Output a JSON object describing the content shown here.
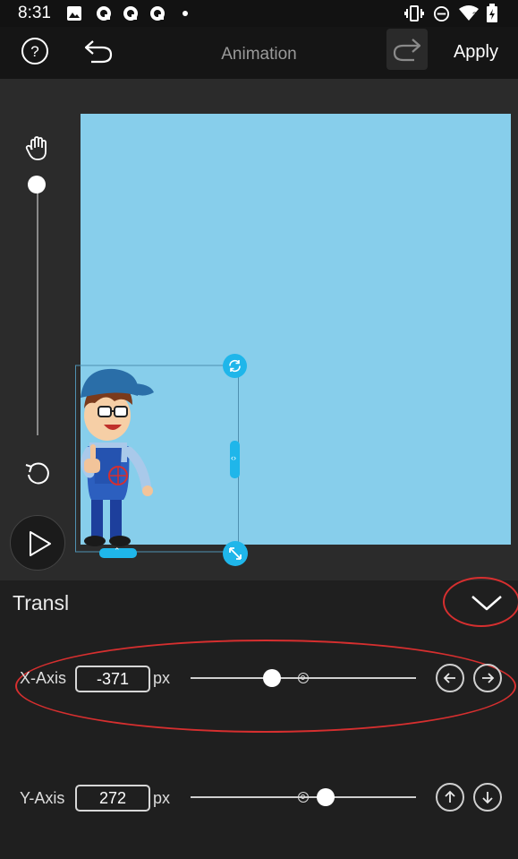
{
  "status_bar": {
    "time": "8:31"
  },
  "toolbar": {
    "title": "Animation",
    "apply_label": "Apply"
  },
  "panel": {
    "title": "Transl",
    "x_axis": {
      "label": "X-Axis",
      "value": "-371",
      "unit": "px"
    },
    "y_axis": {
      "label": "Y-Axis",
      "value": "272",
      "unit": "px"
    }
  },
  "colors": {
    "canvas": "#87ceeb",
    "accent": "#1fb6ea",
    "annotation": "#d62f2f"
  }
}
